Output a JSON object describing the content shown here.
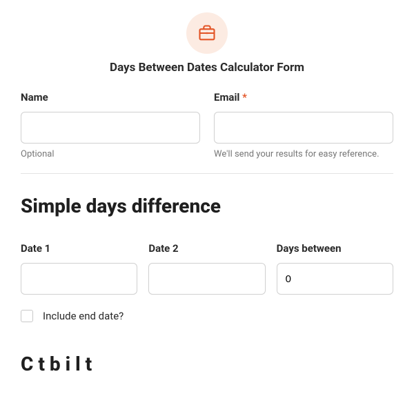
{
  "header": {
    "icon": "briefcase-icon",
    "title": "Days Between Dates Calculator Form"
  },
  "fields": {
    "name": {
      "label": "Name",
      "helper": "Optional",
      "value": ""
    },
    "email": {
      "label": "Email",
      "required_mark": "*",
      "helper": "We'll send your results for easy reference.",
      "value": ""
    }
  },
  "section1": {
    "title": "Simple days difference",
    "date1_label": "Date 1",
    "date1_value": "",
    "date2_label": "Date 2",
    "date2_value": "",
    "days_between_label": "Days between",
    "days_between_value": "0",
    "include_end_label": "Include end date?"
  },
  "section2": {
    "partial_title": "C                   t  b    i                         l    t"
  },
  "colors": {
    "accent": "#e35426",
    "icon_bg": "#fcebe2"
  }
}
